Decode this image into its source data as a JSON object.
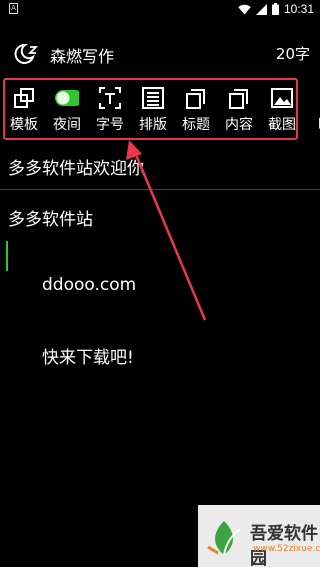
{
  "status_bar": {
    "notif_glyph": "A",
    "time": "10:31"
  },
  "app_bar": {
    "title": "森燃写作",
    "word_count": "20字"
  },
  "toolbar": {
    "items": [
      {
        "label": "模板",
        "icon": "template-icon"
      },
      {
        "label": "夜间",
        "icon": "night-toggle-icon"
      },
      {
        "label": "字号",
        "icon": "font-size-icon"
      },
      {
        "label": "排版",
        "icon": "layout-icon"
      },
      {
        "label": "标题",
        "icon": "title-icon"
      },
      {
        "label": "内容",
        "icon": "content-icon"
      },
      {
        "label": "截图",
        "icon": "screenshot-icon"
      },
      {
        "label": "时",
        "icon": ""
      }
    ]
  },
  "document": {
    "title": "多多软件站欢迎你",
    "paragraphs": [
      "多多软件站",
      "ddooo.com",
      "快来下载吧!"
    ]
  },
  "watermark": {
    "text": "吾爱软件园",
    "url": "www.52zixue.com"
  },
  "colors": {
    "accent_green": "#2ec82e",
    "highlight_red": "#e8384b",
    "background": "#000000"
  }
}
